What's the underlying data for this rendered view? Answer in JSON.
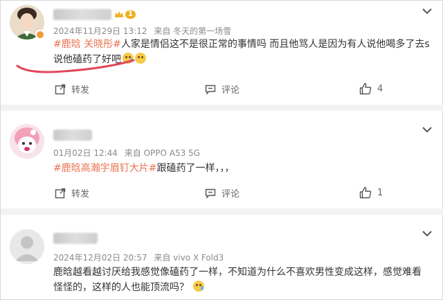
{
  "comments": [
    {
      "time": "2024年11月29日 13:12",
      "source": "来自 冬天的第一场雪",
      "badge_level": "1",
      "hashtag": "#鹿晗 关晓彤#",
      "text_line1": "人家是情侣这不是很正常的事情吗 而且他骂人是因为有人说他喝多了去s",
      "text_line2": "说他磕药了好吧",
      "repost_label": "转发",
      "comment_label": "评论",
      "like_count": "4"
    },
    {
      "time": "01月02日 12:44",
      "source": "来自 OPPO A53 5G",
      "hashtag": "#鹿晗高瀚宇眉钉大片#",
      "text_line1": "跟磕药了一样，，，",
      "repost_label": "转发",
      "comment_label": "评论",
      "like_count": "1"
    },
    {
      "time": "2024年12月02日 20:57",
      "source": "来自 vivo X Fold3",
      "text_line1": "鹿晗越看越讨厌给我感觉像磕药了一样，不知道为什么不喜欢男性变成这样，感觉难看",
      "text_line2": "怪怪的，这样的人也能顶流吗？"
    }
  ],
  "colors": {
    "hashtag": "#eb7350",
    "annotation": "#e0475b"
  }
}
